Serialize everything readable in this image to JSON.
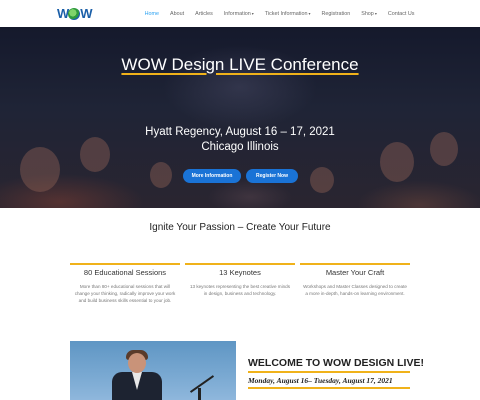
{
  "header": {
    "logo_text_left": "W",
    "logo_text_right": "W",
    "nav": [
      {
        "label": "Home",
        "active": true,
        "dropdown": false
      },
      {
        "label": "About",
        "active": false,
        "dropdown": false
      },
      {
        "label": "Articles",
        "active": false,
        "dropdown": false
      },
      {
        "label": "Information",
        "active": false,
        "dropdown": true
      },
      {
        "label": "Ticket Information",
        "active": false,
        "dropdown": true
      },
      {
        "label": "Registration",
        "active": false,
        "dropdown": false
      },
      {
        "label": "Shop",
        "active": false,
        "dropdown": true
      },
      {
        "label": "Contact Us",
        "active": false,
        "dropdown": false
      }
    ],
    "caret_glyph": "▾"
  },
  "hero": {
    "title": "WOW Design LIVE Conference",
    "venue": "Hyatt Regency, August 16 – 17, 2021",
    "location": "Chicago Illinois",
    "more_info_label": "More Information",
    "register_label": "Register Now"
  },
  "tagline": "Ignite Your Passion – Create Your Future",
  "features": [
    {
      "title": "80 Educational Sessions",
      "description": "More than 80+ educational sessions that will change your thinking, radically improve your work and build business skills essential to your job."
    },
    {
      "title": "13 Keynotes",
      "description": "13 keynotes representing the best creative minds in design, business and technology."
    },
    {
      "title": "Master Your Craft",
      "description": "Workshops and Master Classes designed to create a more in-depth, hands-on learning environment."
    }
  ],
  "welcome": {
    "heading": "WELCOME TO WOW DESIGN LIVE!",
    "dates": "Monday, August 16– Tuesday, August 17, 2021"
  },
  "colors": {
    "accent": "#f0b21a",
    "button": "#1a73d6",
    "nav_active": "#2ea3f2"
  }
}
